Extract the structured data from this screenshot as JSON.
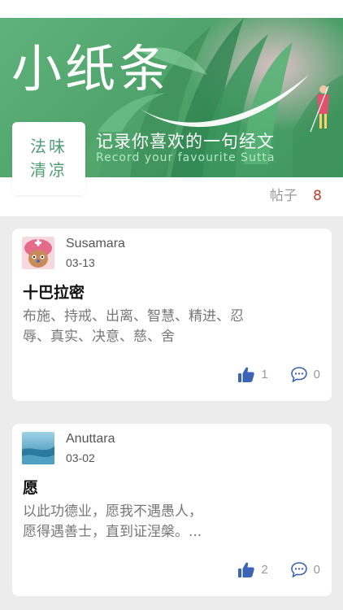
{
  "banner": {
    "title": "小纸条",
    "subtitle": "记录你喜欢的一句经文",
    "subtitle_en": "Record your favourite Sutta"
  },
  "logo": {
    "line1": "法味",
    "line2": "清凉"
  },
  "header": {
    "posts_label": "帖子",
    "posts_count": "8"
  },
  "posts": [
    {
      "user": "Susamara",
      "date": "03-13",
      "title": "十巴拉密",
      "body_line1": "布施、持戒、出离、智慧、精进、忍",
      "body_line2": "辱、真实、决意、慈、舍",
      "likes": "1",
      "comments": "0"
    },
    {
      "user": "Anuttara",
      "date": "03-02",
      "title": "愿",
      "body_line1": "以此功德业，愿我不遇愚人，",
      "body_line2": "愿得遇善士，直到证涅槃。...",
      "likes": "2",
      "comments": "0"
    }
  ],
  "colors": {
    "banner_green": "#4ea36a",
    "logo_text": "#4f9e74",
    "count_red": "#c0392b",
    "like_blue": "#3b64b5"
  },
  "icons": {
    "like": "thumbs-up-icon",
    "comment": "comment-icon"
  }
}
